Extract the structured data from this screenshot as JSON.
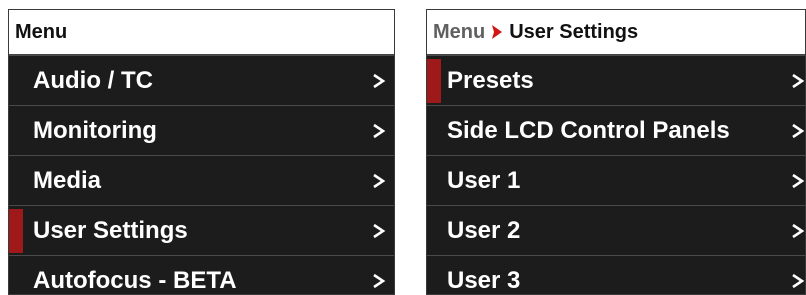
{
  "left_panel": {
    "header": {
      "title": "Menu"
    },
    "items": [
      {
        "label": "Audio / TC",
        "selected": false
      },
      {
        "label": "Monitoring",
        "selected": false
      },
      {
        "label": "Media",
        "selected": false
      },
      {
        "label": "User Settings",
        "selected": true
      },
      {
        "label": "Autofocus - BETA",
        "selected": false
      }
    ]
  },
  "right_panel": {
    "header": {
      "parent": "Menu",
      "separator_icon": "chevron-right-icon",
      "current": "User Settings"
    },
    "items": [
      {
        "label": "Presets",
        "selected": true
      },
      {
        "label": "Side LCD Control Panels",
        "selected": false
      },
      {
        "label": "User 1",
        "selected": false
      },
      {
        "label": "User 2",
        "selected": false
      },
      {
        "label": "User 3",
        "selected": false
      }
    ]
  },
  "colors": {
    "panel_bg": "#1c1c1c",
    "header_bg": "#ffffff",
    "selection_marker": "#9e1a1a",
    "breadcrumb_separator": "#d31515",
    "text": "#ffffff"
  }
}
